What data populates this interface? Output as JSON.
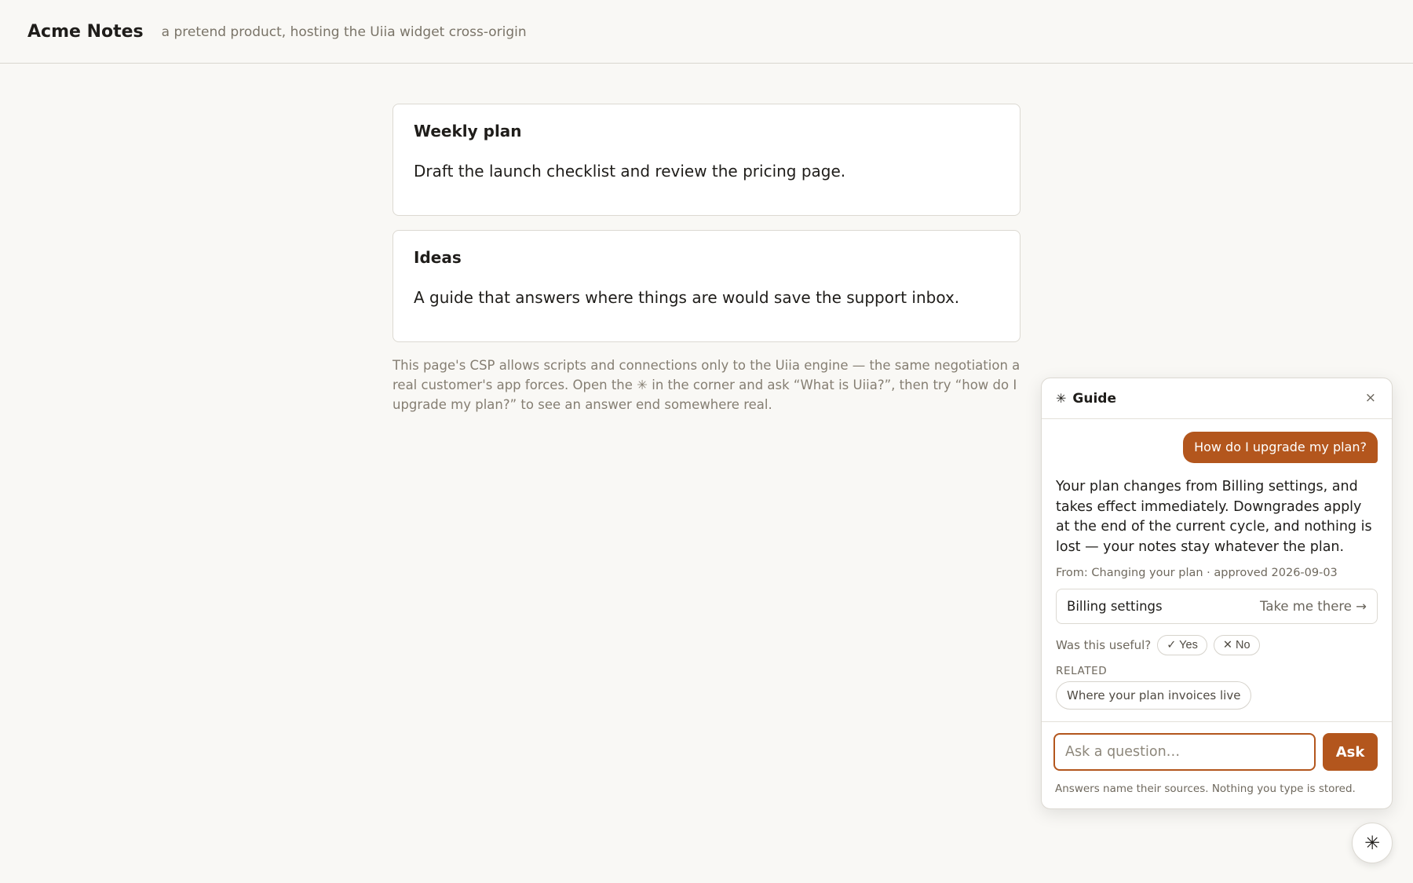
{
  "header": {
    "brand": "Acme Notes",
    "tagline": "a pretend product, hosting the Uiia widget cross-origin"
  },
  "cards": [
    {
      "title": "Weekly plan",
      "body": "Draft the launch checklist and review the pricing page."
    },
    {
      "title": "Ideas",
      "body": "A guide that answers where things are would save the support inbox."
    }
  ],
  "note": "This page's CSP allows scripts and connections only to the Uiia engine — the same negotiation a real customer's app forces. Open the ✳ in the corner and ask “What is Uiia?”, then try “how do I upgrade my plan?” to see an answer end somewhere real.",
  "widget": {
    "logo_icon": "✳",
    "title": "Guide",
    "close_icon": "×",
    "user_message": "How do I upgrade my plan?",
    "answer": "Your plan changes from Billing settings, and takes effect immediately. Downgrades apply at the end of the current cycle, and nothing is lost — your notes stay whatever the plan.",
    "source": "From: Changing your plan · approved 2026-09-03",
    "link": {
      "name": "Billing settings",
      "action": "Take me there →"
    },
    "feedback": {
      "label": "Was this useful?",
      "yes": "✓ Yes",
      "no": "✕ No"
    },
    "related": {
      "label": "RELATED",
      "items": [
        "Where your plan invoices live"
      ]
    },
    "input": {
      "placeholder": "Ask a question…",
      "value": ""
    },
    "ask_label": "Ask",
    "disclaimer": "Answers name their sources. Nothing you type is stored."
  },
  "fab_icon": "✳",
  "colors": {
    "accent": "#b3561d",
    "background": "#f9f8f5"
  }
}
